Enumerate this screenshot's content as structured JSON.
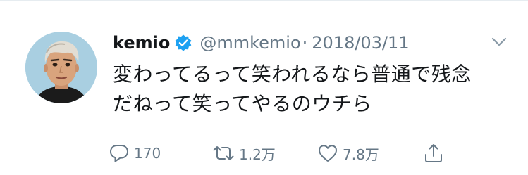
{
  "tweet": {
    "display_name": "kemio",
    "handle": "@mmkemio",
    "separator": "·",
    "date": "2018/03/11",
    "verified": true,
    "text_lines": [
      "変わってるって笑われるなら普通で残念",
      "だねって笑ってやるのウチら"
    ]
  },
  "actions": {
    "replies": "170",
    "retweets": "1.2万",
    "likes": "7.8万"
  },
  "colors": {
    "accent": "#1da1f2",
    "text": "#14171a",
    "secondary": "#657786",
    "avatar_bg": "#a9cfe1"
  },
  "icons": {
    "verified": "verified-badge-icon",
    "menu": "chevron-down-icon",
    "reply": "reply-bubble-icon",
    "retweet": "retweet-icon",
    "like": "heart-icon",
    "share": "share-icon"
  }
}
